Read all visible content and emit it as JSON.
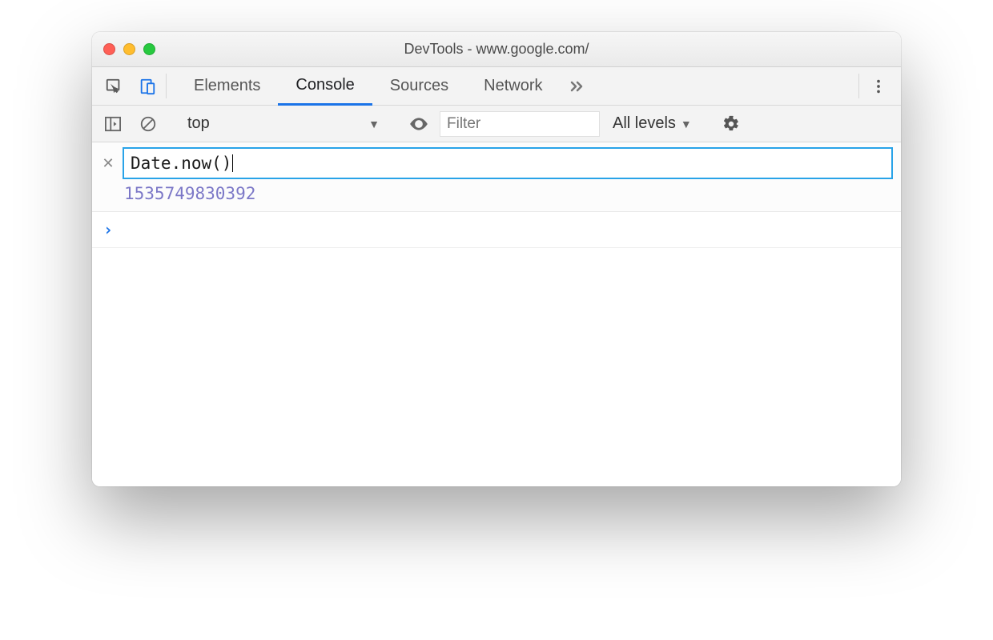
{
  "window": {
    "title": "DevTools - www.google.com/"
  },
  "tabs": {
    "elements": "Elements",
    "console": "Console",
    "sources": "Sources",
    "network": "Network"
  },
  "console_toolbar": {
    "context": "top",
    "filter_placeholder": "Filter",
    "levels": "All levels"
  },
  "console": {
    "input_expression": "Date.now()",
    "eager_result": "1535749830392"
  }
}
